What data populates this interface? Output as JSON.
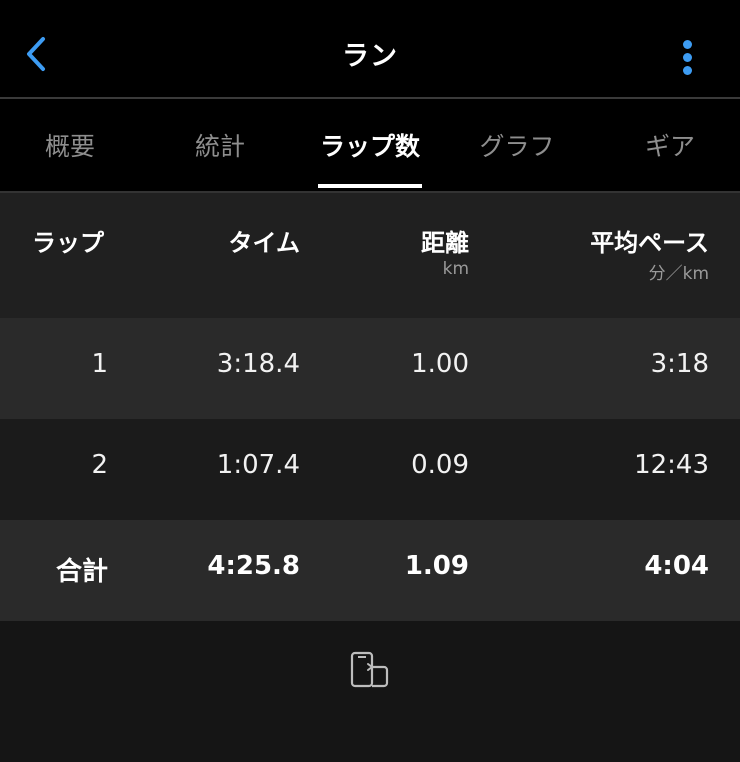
{
  "header": {
    "title": "ラン",
    "back_icon": "chevron-left-icon",
    "menu_icon": "more-vertical-icon",
    "accent_color": "#3d9cf3"
  },
  "tabs": [
    {
      "label": "概要",
      "active": false
    },
    {
      "label": "統計",
      "active": false
    },
    {
      "label": "ラップ数",
      "active": true
    },
    {
      "label": "グラフ",
      "active": false
    },
    {
      "label": "ギア",
      "active": false
    }
  ],
  "table": {
    "columns": [
      {
        "label": "ラップ",
        "unit": ""
      },
      {
        "label": "タイム",
        "unit": ""
      },
      {
        "label": "距離",
        "unit": "km"
      },
      {
        "label": "平均ペース",
        "unit": "分／km"
      }
    ],
    "rows": [
      {
        "lap": "1",
        "time": "3:18.4",
        "distance": "1.00",
        "pace": "3:18"
      },
      {
        "lap": "2",
        "time": "1:07.4",
        "distance": "0.09",
        "pace": "12:43"
      }
    ],
    "total": {
      "lap": "合計",
      "time": "4:25.8",
      "distance": "1.09",
      "pace": "4:04"
    }
  },
  "footer": {
    "icon": "device-sync-icon"
  }
}
